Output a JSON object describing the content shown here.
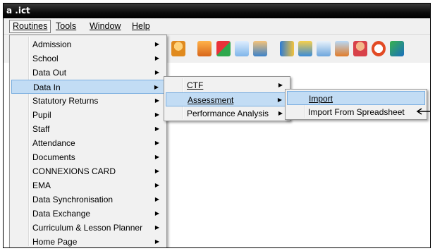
{
  "window": {
    "title": "a .ict"
  },
  "menubar": {
    "items": [
      {
        "label": "Routines"
      },
      {
        "label": "Tools"
      },
      {
        "label": "Window"
      },
      {
        "label": "Help"
      }
    ]
  },
  "menu_routines": {
    "items": [
      {
        "label": "Admission"
      },
      {
        "label": "School"
      },
      {
        "label": "Data Out"
      },
      {
        "label": "Data In"
      },
      {
        "label": "Statutory Returns"
      },
      {
        "label": "Pupil"
      },
      {
        "label": "Staff"
      },
      {
        "label": "Attendance"
      },
      {
        "label": "Documents"
      },
      {
        "label": "CONNEXIONS CARD"
      },
      {
        "label": "EMA"
      },
      {
        "label": "Data Synchronisation"
      },
      {
        "label": "Data Exchange"
      },
      {
        "label": "Curriculum & Lesson Planner"
      },
      {
        "label": "Home Page"
      }
    ]
  },
  "menu_data_in": {
    "items": [
      {
        "label": "CTF"
      },
      {
        "label": "Assessment"
      },
      {
        "label": "Performance Analysis"
      }
    ]
  },
  "menu_assessment": {
    "items": [
      {
        "label": "Import"
      },
      {
        "label": "Import From Spreadsheet"
      }
    ]
  },
  "icons": [
    "globe-icon",
    "person-icon",
    "book-icon",
    "flag-icon",
    "envelope-icon",
    "contact-icon",
    "chart-icon",
    "people-icon",
    "list-icon",
    "edit-icon",
    "user-icon",
    "clock-icon",
    "arrow-icon"
  ]
}
